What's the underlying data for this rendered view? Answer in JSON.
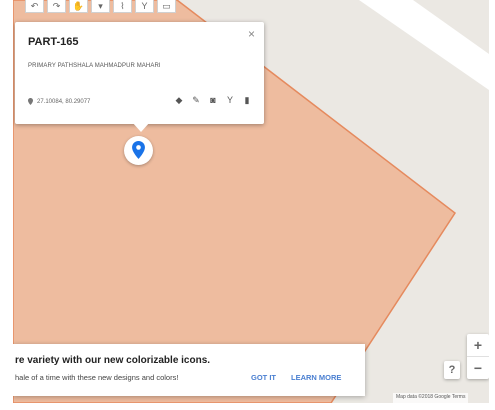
{
  "map": {
    "colors": {
      "background": "#ebe8e3",
      "polygon_fill": "#eebc9f",
      "polygon_stroke": "#e58a5e",
      "road": "#ffffff",
      "marker": "#1a73e8"
    }
  },
  "toolbar": {
    "tools": [
      {
        "icon": "undo-icon",
        "glyph": "↶"
      },
      {
        "icon": "redo-icon",
        "glyph": "↷"
      },
      {
        "icon": "hand-icon",
        "glyph": "✋"
      },
      {
        "icon": "marker-icon",
        "glyph": "▾"
      },
      {
        "icon": "line-icon",
        "glyph": "⌇"
      },
      {
        "icon": "route-icon",
        "glyph": "Y"
      },
      {
        "icon": "ruler-icon",
        "glyph": "▭"
      }
    ]
  },
  "popup": {
    "title": "PART-165",
    "description": "PRIMARY PATHSHALA MAHMADPUR MAHARI",
    "coordinates": "27.10084, 80.29077",
    "close_glyph": "×",
    "actions": [
      {
        "icon": "paint-bucket-icon",
        "glyph": "◆"
      },
      {
        "icon": "edit-pencil-icon",
        "glyph": "✎"
      },
      {
        "icon": "camera-icon",
        "glyph": "◙"
      },
      {
        "icon": "directions-icon",
        "glyph": "Y"
      },
      {
        "icon": "trash-icon",
        "glyph": "▮"
      }
    ]
  },
  "banner": {
    "title": "re variety with our new colorizable icons.",
    "body": "hale of a time with these new designs and colors!",
    "got_it": "GOT IT",
    "learn_more": "LEARN MORE"
  },
  "controls": {
    "zoom_in": "+",
    "zoom_out": "−",
    "help": "?"
  },
  "attribution": "Map data ©2018 Google   Terms"
}
